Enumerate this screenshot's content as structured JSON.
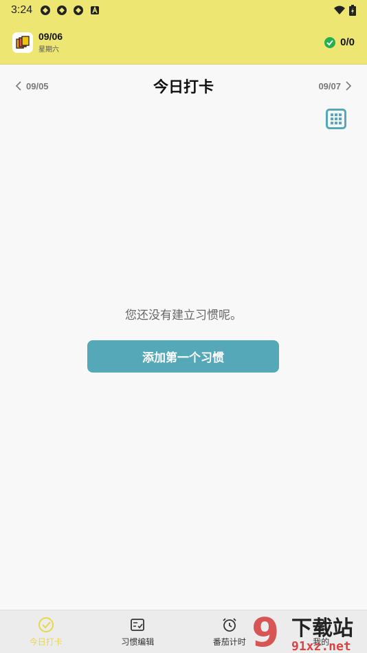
{
  "status_bar": {
    "time": "3:24"
  },
  "header": {
    "date": "09/06",
    "weekday": "星期六",
    "progress": "0/0"
  },
  "date_nav": {
    "prev": "09/05",
    "title": "今日打卡",
    "next": "09/07"
  },
  "empty_state": {
    "message": "您还没有建立习惯呢。",
    "button": "添加第一个习惯"
  },
  "bottom_nav": {
    "items": [
      {
        "label": "今日打卡",
        "icon": "check-circle-icon",
        "active": true
      },
      {
        "label": "习惯编辑",
        "icon": "edit-list-icon",
        "active": false
      },
      {
        "label": "番茄计时",
        "icon": "alarm-clock-icon",
        "active": false
      },
      {
        "label": "我的",
        "icon": "profile-icon",
        "active": false
      }
    ]
  },
  "watermark": {
    "text_top": "下载站",
    "text_bottom": "91xz.net",
    "logo": "9"
  },
  "colors": {
    "accent_yellow": "#ede673",
    "button_teal": "#55a8b8",
    "check_green": "#22b14c"
  }
}
